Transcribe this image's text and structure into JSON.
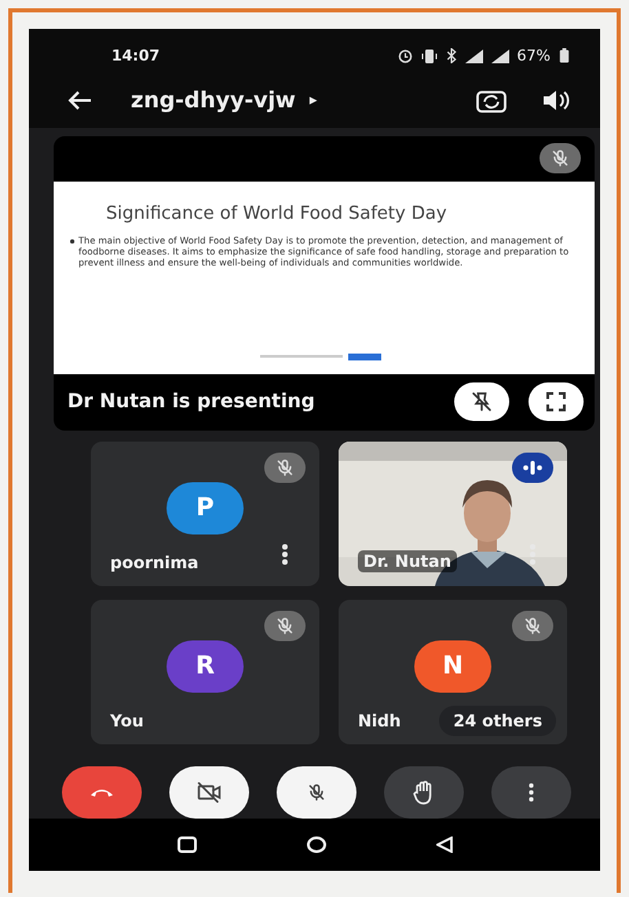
{
  "status_bar": {
    "time": "14:07",
    "battery": "67%"
  },
  "header": {
    "title": "zng-dhyy-vjw",
    "title_caret": "▸"
  },
  "presentation": {
    "muted": true,
    "slide": {
      "title": "Significance of World Food Safety Day",
      "bullets": [
        "The main objective of World Food Safety Day is to promote the prevention, detection, and management of foodborne diseases. It aims to emphasize the significance of safe food handling, storage and preparation to prevent illness and ensure the well-being of individuals and communities worldwide."
      ]
    },
    "presenter_label": "Dr Nutan is presenting"
  },
  "tiles": [
    {
      "kind": "avatar",
      "initial": "P",
      "color": "#1e88d8",
      "name": "poornima",
      "muted": true,
      "menu": true
    },
    {
      "kind": "video",
      "name": "Dr. Nutan",
      "speaking": true,
      "menu": true
    },
    {
      "kind": "avatar",
      "initial": "R",
      "color": "#6a3fc8",
      "name": "You",
      "muted": true,
      "menu": false
    },
    {
      "kind": "avatar",
      "initial": "N",
      "color": "#f0582a",
      "name": "Nidh",
      "muted": true,
      "menu": false,
      "overlay": "24 others"
    }
  ],
  "controls": [
    {
      "kind": "end-call"
    },
    {
      "kind": "camera",
      "on": false
    },
    {
      "kind": "mic",
      "on": false
    },
    {
      "kind": "raise-hand"
    },
    {
      "kind": "more"
    }
  ]
}
